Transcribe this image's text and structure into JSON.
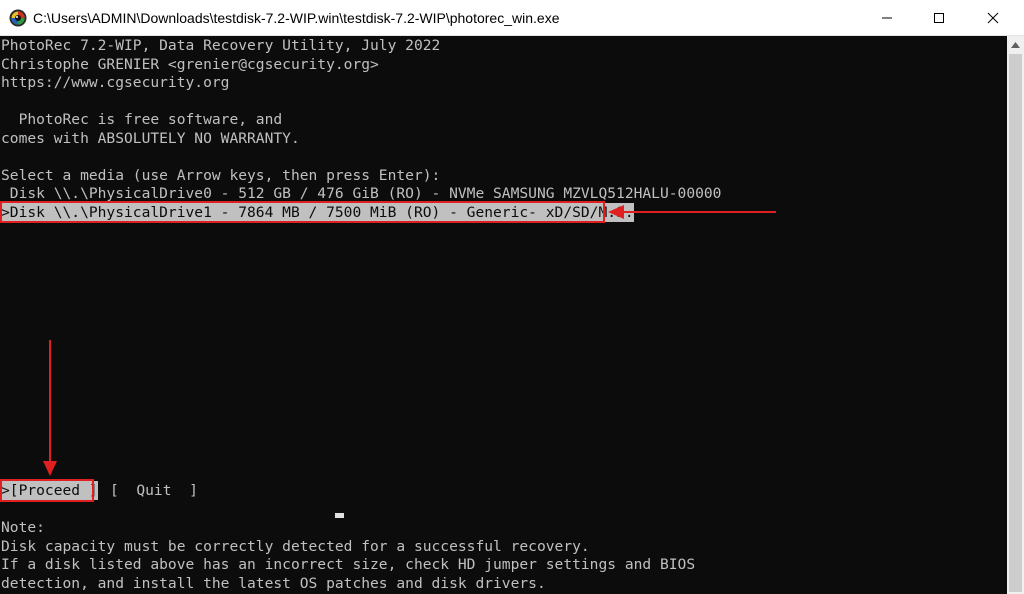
{
  "window": {
    "title": "C:\\Users\\ADMIN\\Downloads\\testdisk-7.2-WIP.win\\testdisk-7.2-WIP\\photorec_win.exe",
    "app_icon": "photorec-icon"
  },
  "console": {
    "header": [
      "PhotoRec 7.2-WIP, Data Recovery Utility, July 2022",
      "Christophe GRENIER <grenier@cgsecurity.org>",
      "https://www.cgsecurity.org"
    ],
    "license": [
      "  PhotoRec is free software, and",
      "comes with ABSOLUTELY NO WARRANTY."
    ],
    "prompt": "Select a media (use Arrow keys, then press Enter):",
    "media": [
      {
        "label": " Disk \\\\.\\PhysicalDrive0 - 512 GB / 476 GiB (RO) - NVMe SAMSUNG MZVLQ512HALU-00000",
        "selected": false
      },
      {
        "label": ">Disk \\\\.\\PhysicalDrive1 - 7864 MB / 7500 MiB (RO) - Generic- xD/SD/M.S.",
        "selected": true
      }
    ],
    "actions": {
      "proceed": ">[Proceed ]",
      "quit": "[  Quit  ]"
    },
    "note": [
      "Note:",
      "Disk capacity must be correctly detected for a successful recovery.",
      "If a disk listed above has an incorrect size, check HD jumper settings and BIOS",
      "detection, and install the latest OS patches and disk drivers."
    ]
  },
  "colors": {
    "console_bg": "#0c0c0c",
    "console_fg": "#c0c0c0",
    "annotation": "#e02020"
  }
}
